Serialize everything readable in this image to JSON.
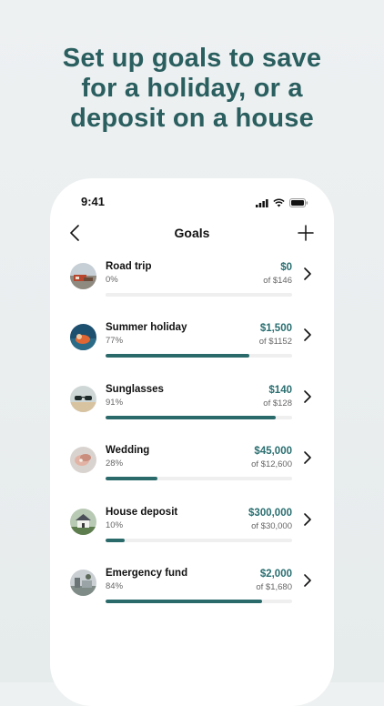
{
  "headline": [
    "Set up goals to save",
    "for a holiday, or a",
    "deposit on a house"
  ],
  "status_bar": {
    "time": "9:41"
  },
  "navbar": {
    "title": "Goals",
    "back_icon": "chevron-left-icon",
    "add_icon": "plus-icon"
  },
  "goals": [
    {
      "name": "Road trip",
      "percent_label": "0%",
      "amount": "$0",
      "target": "of $146",
      "progress": 0.0,
      "image": "road-trip-photo"
    },
    {
      "name": "Summer holiday",
      "percent_label": "77%",
      "amount": "$1,500",
      "target": "of $1152",
      "progress": 0.77,
      "image": "summer-holiday-photo"
    },
    {
      "name": "Sunglasses",
      "percent_label": "91%",
      "amount": "$140",
      "target": "of $128",
      "progress": 0.91,
      "image": "sunglasses-photo"
    },
    {
      "name": "Wedding",
      "percent_label": "28%",
      "amount": "$45,000",
      "target": "of $12,600",
      "progress": 0.28,
      "image": "wedding-photo"
    },
    {
      "name": "House deposit",
      "percent_label": "10%",
      "amount": "$300,000",
      "target": "of $30,000",
      "progress": 0.1,
      "image": "house-photo"
    },
    {
      "name": "Emergency fund",
      "percent_label": "84%",
      "amount": "$2,000",
      "target": "of $1,680",
      "progress": 0.84,
      "image": "emergency-fund-photo"
    }
  ],
  "colors": {
    "accent": "#2a5e5f",
    "progress": "#2a6a6b",
    "track": "#efefef"
  }
}
